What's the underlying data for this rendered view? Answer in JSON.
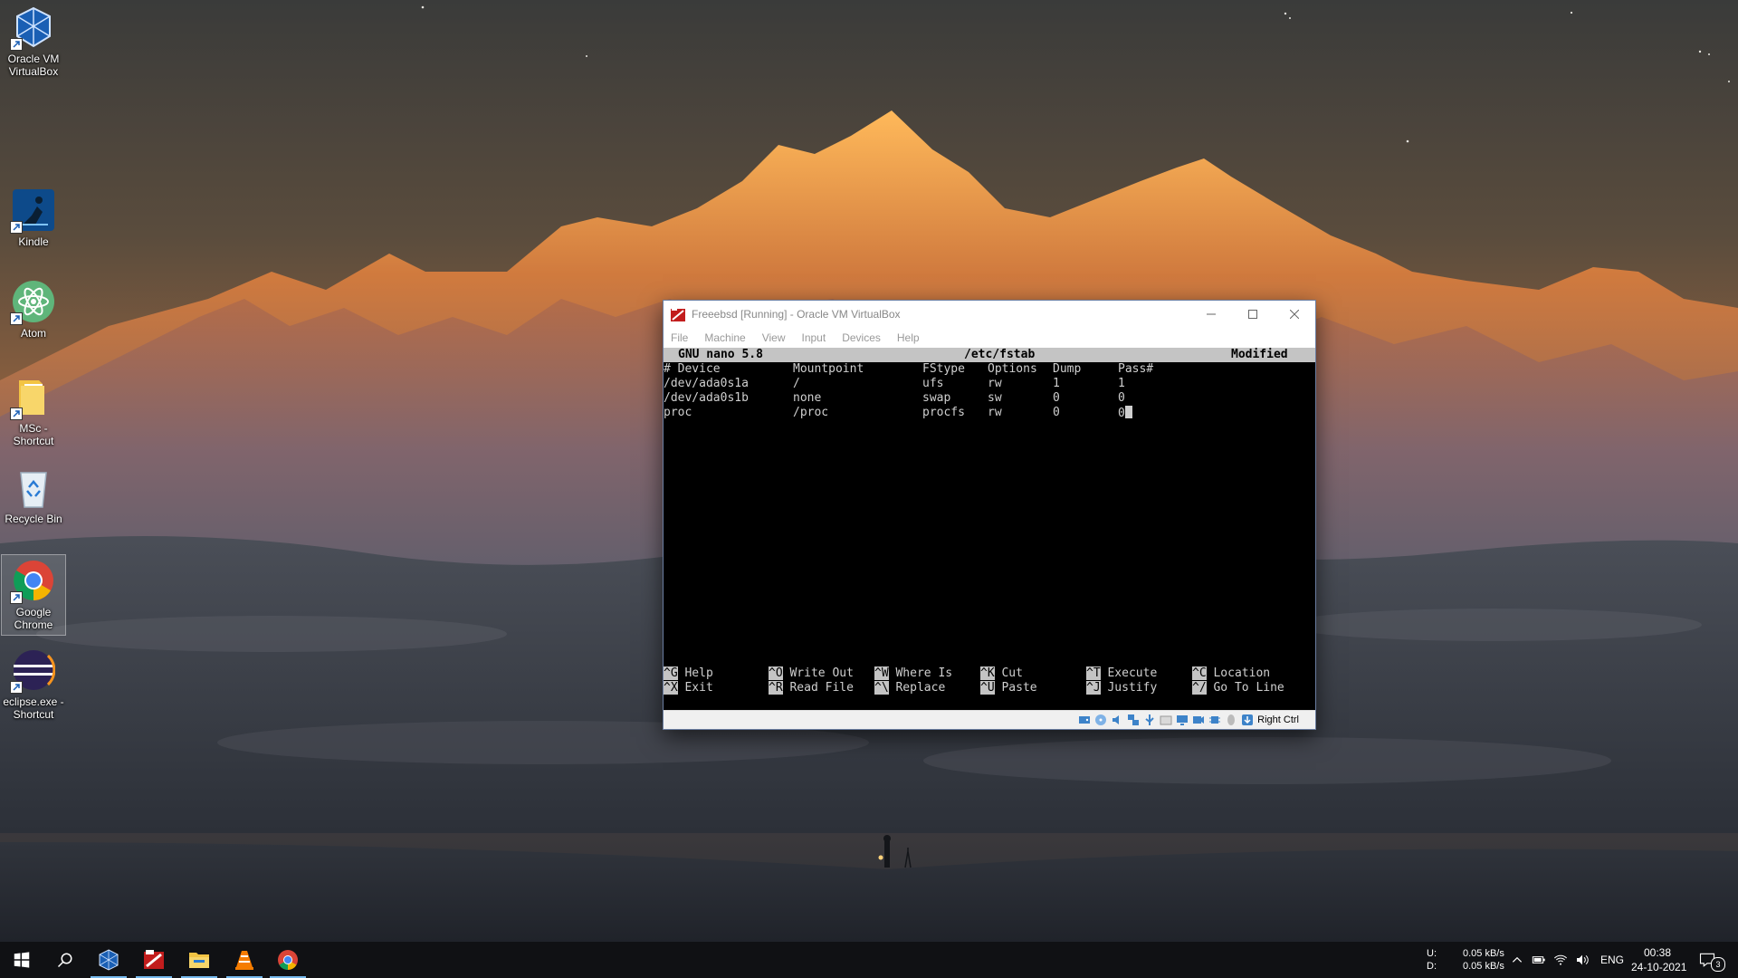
{
  "desktop": {
    "icons": [
      {
        "label_line1": "Oracle VM",
        "label_line2": "VirtualBox"
      },
      {
        "label_line1": "Kindle",
        "label_line2": ""
      },
      {
        "label_line1": "Atom",
        "label_line2": ""
      },
      {
        "label_line1": "MSc -",
        "label_line2": "Shortcut"
      },
      {
        "label_line1": "Recycle Bin",
        "label_line2": ""
      },
      {
        "label_line1": "Google",
        "label_line2": "Chrome"
      },
      {
        "label_line1": "eclipse.exe -",
        "label_line2": "Shortcut"
      }
    ]
  },
  "vbox": {
    "title": "Freeebsd [Running] - Oracle VM VirtualBox",
    "menu": [
      "File",
      "Machine",
      "View",
      "Input",
      "Devices",
      "Help"
    ],
    "status_host_key": "Right Ctrl"
  },
  "nano": {
    "version": "GNU nano 5.8",
    "filename": "/etc/fstab",
    "state": "Modified",
    "lines": [
      {
        "device": "# Device",
        "mount": "Mountpoint",
        "fstype": "FStype",
        "options": "Options",
        "dump": "Dump",
        "pass": "Pass#"
      },
      {
        "device": "/dev/ada0s1a",
        "mount": "/",
        "fstype": "ufs",
        "options": "rw",
        "dump": "1",
        "pass": "1"
      },
      {
        "device": "/dev/ada0s1b",
        "mount": "none",
        "fstype": "swap",
        "options": "sw",
        "dump": "0",
        "pass": "0"
      },
      {
        "device": "proc",
        "mount": "/proc",
        "fstype": "procfs",
        "options": "rw",
        "dump": "0",
        "pass": "0"
      }
    ],
    "shortcuts": [
      {
        "key": "^G",
        "label": "Help"
      },
      {
        "key": "^X",
        "label": "Exit"
      },
      {
        "key": "^O",
        "label": "Write Out"
      },
      {
        "key": "^R",
        "label": "Read File"
      },
      {
        "key": "^W",
        "label": "Where Is"
      },
      {
        "key": "^\\",
        "label": "Replace"
      },
      {
        "key": "^K",
        "label": "Cut"
      },
      {
        "key": "^U",
        "label": "Paste"
      },
      {
        "key": "^T",
        "label": "Execute"
      },
      {
        "key": "^J",
        "label": "Justify"
      },
      {
        "key": "^C",
        "label": "Location"
      },
      {
        "key": "^/",
        "label": "Go To Line"
      }
    ]
  },
  "taskbar": {
    "net_up_label": "U:",
    "net_down_label": "D:",
    "net_up": "0.05 kB/s",
    "net_down": "0.05 kB/s",
    "language": "ENG",
    "time": "00:38",
    "date": "24-10-2021",
    "notification_count": "3"
  },
  "colors": {
    "sky_top": "#3d3d3b",
    "sky_glow": "#b7773f",
    "mountain_lit": "#f2a24a",
    "fog": "#3a3e46",
    "taskbar": "#101114",
    "terminal_bg": "#000000",
    "terminal_fg": "#cfcfcf",
    "nano_bar": "#c4c4c4"
  }
}
